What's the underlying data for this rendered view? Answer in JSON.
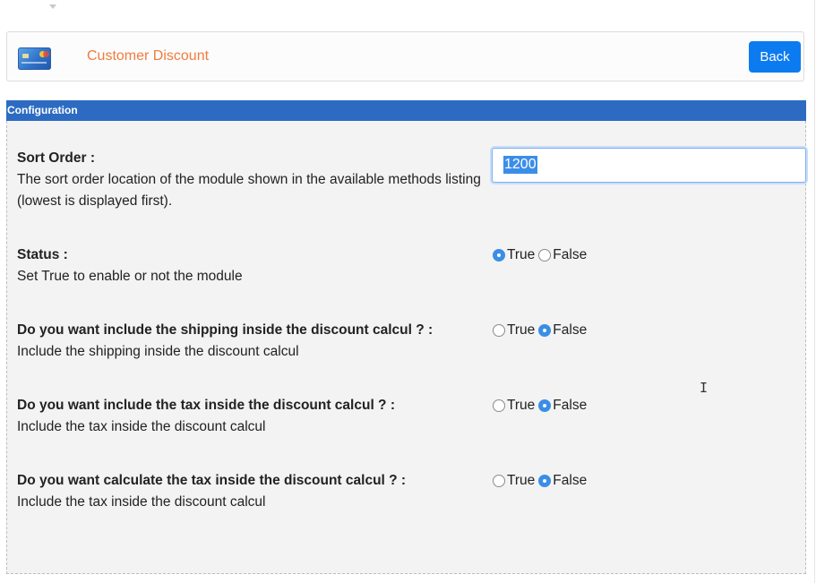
{
  "header": {
    "title": "Customer Discount",
    "back_label": "Back",
    "icon": "credit-card-icon"
  },
  "config": {
    "section_label": "Configuration"
  },
  "settings": [
    {
      "title": "Sort Order :",
      "description": "The sort order location of the module shown in the available methods listing (lowest is displayed first).",
      "value": "1200"
    },
    {
      "title": "Status :",
      "description": "Set True to enable or not the module",
      "options": [
        "True",
        "False"
      ],
      "selected": "True"
    },
    {
      "title": "Do you want include the shipping inside the discount calcul ? :",
      "description": "Include the shipping inside the discount calcul",
      "options": [
        "True",
        "False"
      ],
      "selected": "False"
    },
    {
      "title": "Do you want include the tax inside the discount calcul ? :",
      "description": "Include the tax inside the discount calcul",
      "options": [
        "True",
        "False"
      ],
      "selected": "False"
    },
    {
      "title": "Do you want calculate the tax inside the discount calcul ? :",
      "description": "Include the tax inside the discount calcul",
      "options": [
        "True",
        "False"
      ],
      "selected": "False"
    }
  ],
  "colors": {
    "accent": "#0d7bf0",
    "title_orange": "#f07c3e",
    "config_bar": "#2d6bc3"
  }
}
